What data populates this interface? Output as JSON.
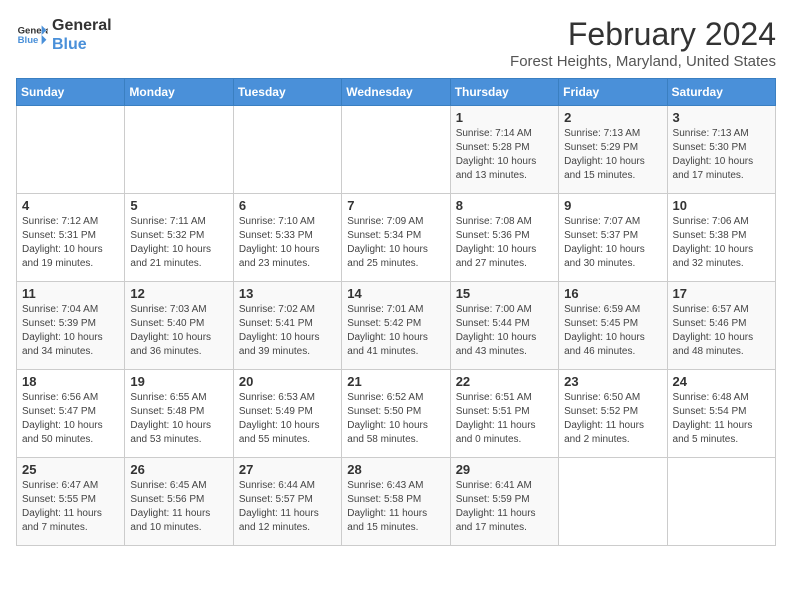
{
  "header": {
    "logo_line1": "General",
    "logo_line2": "Blue",
    "month": "February 2024",
    "location": "Forest Heights, Maryland, United States"
  },
  "weekdays": [
    "Sunday",
    "Monday",
    "Tuesday",
    "Wednesday",
    "Thursday",
    "Friday",
    "Saturday"
  ],
  "weeks": [
    [
      {
        "day": "",
        "info": ""
      },
      {
        "day": "",
        "info": ""
      },
      {
        "day": "",
        "info": ""
      },
      {
        "day": "",
        "info": ""
      },
      {
        "day": "1",
        "info": "Sunrise: 7:14 AM\nSunset: 5:28 PM\nDaylight: 10 hours\nand 13 minutes."
      },
      {
        "day": "2",
        "info": "Sunrise: 7:13 AM\nSunset: 5:29 PM\nDaylight: 10 hours\nand 15 minutes."
      },
      {
        "day": "3",
        "info": "Sunrise: 7:13 AM\nSunset: 5:30 PM\nDaylight: 10 hours\nand 17 minutes."
      }
    ],
    [
      {
        "day": "4",
        "info": "Sunrise: 7:12 AM\nSunset: 5:31 PM\nDaylight: 10 hours\nand 19 minutes."
      },
      {
        "day": "5",
        "info": "Sunrise: 7:11 AM\nSunset: 5:32 PM\nDaylight: 10 hours\nand 21 minutes."
      },
      {
        "day": "6",
        "info": "Sunrise: 7:10 AM\nSunset: 5:33 PM\nDaylight: 10 hours\nand 23 minutes."
      },
      {
        "day": "7",
        "info": "Sunrise: 7:09 AM\nSunset: 5:34 PM\nDaylight: 10 hours\nand 25 minutes."
      },
      {
        "day": "8",
        "info": "Sunrise: 7:08 AM\nSunset: 5:36 PM\nDaylight: 10 hours\nand 27 minutes."
      },
      {
        "day": "9",
        "info": "Sunrise: 7:07 AM\nSunset: 5:37 PM\nDaylight: 10 hours\nand 30 minutes."
      },
      {
        "day": "10",
        "info": "Sunrise: 7:06 AM\nSunset: 5:38 PM\nDaylight: 10 hours\nand 32 minutes."
      }
    ],
    [
      {
        "day": "11",
        "info": "Sunrise: 7:04 AM\nSunset: 5:39 PM\nDaylight: 10 hours\nand 34 minutes."
      },
      {
        "day": "12",
        "info": "Sunrise: 7:03 AM\nSunset: 5:40 PM\nDaylight: 10 hours\nand 36 minutes."
      },
      {
        "day": "13",
        "info": "Sunrise: 7:02 AM\nSunset: 5:41 PM\nDaylight: 10 hours\nand 39 minutes."
      },
      {
        "day": "14",
        "info": "Sunrise: 7:01 AM\nSunset: 5:42 PM\nDaylight: 10 hours\nand 41 minutes."
      },
      {
        "day": "15",
        "info": "Sunrise: 7:00 AM\nSunset: 5:44 PM\nDaylight: 10 hours\nand 43 minutes."
      },
      {
        "day": "16",
        "info": "Sunrise: 6:59 AM\nSunset: 5:45 PM\nDaylight: 10 hours\nand 46 minutes."
      },
      {
        "day": "17",
        "info": "Sunrise: 6:57 AM\nSunset: 5:46 PM\nDaylight: 10 hours\nand 48 minutes."
      }
    ],
    [
      {
        "day": "18",
        "info": "Sunrise: 6:56 AM\nSunset: 5:47 PM\nDaylight: 10 hours\nand 50 minutes."
      },
      {
        "day": "19",
        "info": "Sunrise: 6:55 AM\nSunset: 5:48 PM\nDaylight: 10 hours\nand 53 minutes."
      },
      {
        "day": "20",
        "info": "Sunrise: 6:53 AM\nSunset: 5:49 PM\nDaylight: 10 hours\nand 55 minutes."
      },
      {
        "day": "21",
        "info": "Sunrise: 6:52 AM\nSunset: 5:50 PM\nDaylight: 10 hours\nand 58 minutes."
      },
      {
        "day": "22",
        "info": "Sunrise: 6:51 AM\nSunset: 5:51 PM\nDaylight: 11 hours\nand 0 minutes."
      },
      {
        "day": "23",
        "info": "Sunrise: 6:50 AM\nSunset: 5:52 PM\nDaylight: 11 hours\nand 2 minutes."
      },
      {
        "day": "24",
        "info": "Sunrise: 6:48 AM\nSunset: 5:54 PM\nDaylight: 11 hours\nand 5 minutes."
      }
    ],
    [
      {
        "day": "25",
        "info": "Sunrise: 6:47 AM\nSunset: 5:55 PM\nDaylight: 11 hours\nand 7 minutes."
      },
      {
        "day": "26",
        "info": "Sunrise: 6:45 AM\nSunset: 5:56 PM\nDaylight: 11 hours\nand 10 minutes."
      },
      {
        "day": "27",
        "info": "Sunrise: 6:44 AM\nSunset: 5:57 PM\nDaylight: 11 hours\nand 12 minutes."
      },
      {
        "day": "28",
        "info": "Sunrise: 6:43 AM\nSunset: 5:58 PM\nDaylight: 11 hours\nand 15 minutes."
      },
      {
        "day": "29",
        "info": "Sunrise: 6:41 AM\nSunset: 5:59 PM\nDaylight: 11 hours\nand 17 minutes."
      },
      {
        "day": "",
        "info": ""
      },
      {
        "day": "",
        "info": ""
      }
    ]
  ]
}
